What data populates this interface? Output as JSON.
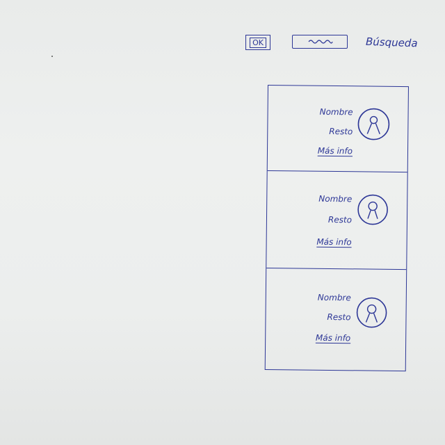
{
  "search": {
    "label": "Búsqueda",
    "button_label": "OK"
  },
  "cards": [
    {
      "name": "Nombre",
      "rest": "Resto",
      "more": "Más info"
    },
    {
      "name": "Nombre",
      "rest": "Resto",
      "more": "Más info"
    },
    {
      "name": "Nombre",
      "rest": "Resto",
      "more": "Más info"
    }
  ],
  "colors": {
    "ink": "#2c3696",
    "paper": "#eceeed"
  }
}
